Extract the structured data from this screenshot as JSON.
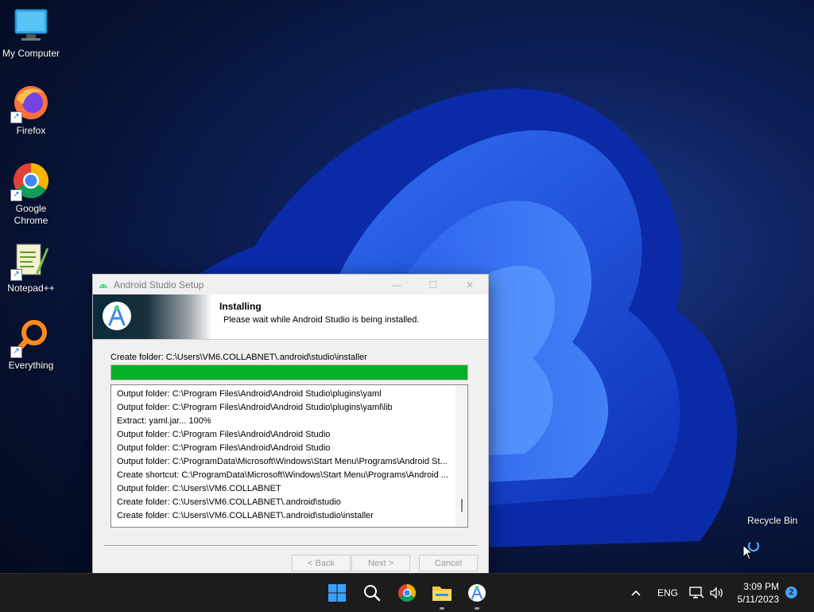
{
  "desktop": {
    "icons": [
      {
        "label": "My Computer"
      },
      {
        "label": "Firefox"
      },
      {
        "label": "Google Chrome"
      },
      {
        "label": "Notepad++"
      },
      {
        "label": "Everything"
      }
    ],
    "recycle_bin_label": "Recycle Bin"
  },
  "window": {
    "title": "Android Studio Setup",
    "header_title": "Installing",
    "header_subtitle": "Please wait while Android Studio is being installed.",
    "status_line": "Create folder: C:\\Users\\VM6.COLLABNET\\.android\\studio\\installer",
    "progress_fraction": 1.0,
    "log_lines": [
      "Output folder: C:\\Program Files\\Android\\Android Studio\\plugins\\yaml",
      "Output folder: C:\\Program Files\\Android\\Android Studio\\plugins\\yaml\\lib",
      "Extract: yaml.jar... 100%",
      "Output folder: C:\\Program Files\\Android\\Android Studio",
      "Output folder: C:\\Program Files\\Android\\Android Studio",
      "Output folder: C:\\ProgramData\\Microsoft\\Windows\\Start Menu\\Programs\\Android St...",
      "Create shortcut: C:\\ProgramData\\Microsoft\\Windows\\Start Menu\\Programs\\Android ...",
      "Output folder: C:\\Users\\VM6.COLLABNET",
      "Create folder: C:\\Users\\VM6.COLLABNET\\.android\\studio",
      "Create folder: C:\\Users\\VM6.COLLABNET\\.android\\studio\\installer"
    ],
    "buttons": {
      "back": "< Back",
      "next": "Next >",
      "cancel": "Cancel"
    }
  },
  "taskbar": {
    "apps": [
      "start-icon",
      "search-icon",
      "chrome-icon",
      "file-explorer-icon",
      "android-studio-icon"
    ],
    "language": "ENG",
    "time": "3:09 PM",
    "date": "5/11/2023",
    "notification_count": "2"
  },
  "colors": {
    "progress": "#06b025",
    "taskbar": "#1c1c1c",
    "accent": "#4a9ff0"
  }
}
